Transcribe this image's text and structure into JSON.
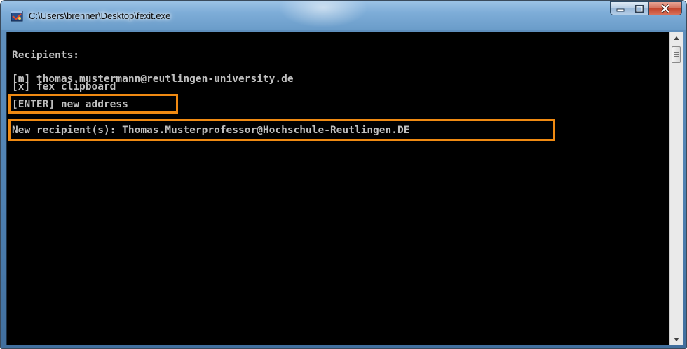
{
  "window": {
    "title": "C:\\Users\\brenner\\Desktop\\fexit.exe",
    "icon": "console-app-icon",
    "accent_color": "#6a9cc9"
  },
  "caption_buttons": {
    "minimize_icon": "minimize-icon",
    "maximize_icon": "maximize-icon",
    "close_icon": "close-icon",
    "close_color": "#c4452c"
  },
  "console": {
    "background": "#000000",
    "text_color": "#c0c0c0",
    "lines": [
      "Recipients:",
      "[m] thomas.mustermann@reutlingen-university.de",
      "[x] fex clipboard",
      "[ENTER] new address",
      "New recipient(s): Thomas.Musterprofessor@Hochschule-Reutlingen.DE"
    ]
  },
  "highlight": {
    "color": "#f08a12"
  },
  "scrollbar": {
    "up_icon": "scroll-up-arrow-icon",
    "down_icon": "scroll-down-arrow-icon"
  }
}
